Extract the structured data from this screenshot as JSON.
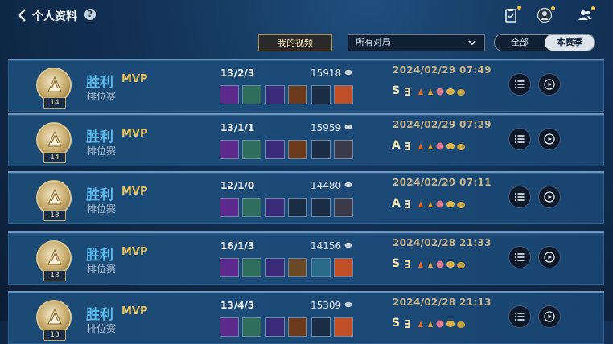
{
  "header": {
    "title": "个人资料",
    "help_label": "?",
    "icons": [
      "back-icon",
      "help-icon",
      "clipboard-icon",
      "avatar-icon",
      "friends-icon"
    ]
  },
  "filters": {
    "my_videos_label": "我的视频",
    "dropdown_value": "所有对局",
    "segment_all": "全部",
    "segment_season": "本赛季"
  },
  "matches": [
    {
      "result": "胜利",
      "mvp": "MVP",
      "mode": "排位赛",
      "level": "14",
      "kda": "13/2/3",
      "gold": "15918",
      "date": "2024/02/29 07:49",
      "rank": "S",
      "items": [
        "#5c2a8c",
        "#2f6d5c",
        "#3a2a7a",
        "#6b3a1a",
        "",
        "#c0502a"
      ]
    },
    {
      "result": "胜利",
      "mvp": "MVP",
      "mode": "排位赛",
      "level": "14",
      "kda": "13/1/1",
      "gold": "15959",
      "date": "2024/02/29 07:29",
      "rank": "A",
      "items": [
        "#5c2a8c",
        "#2f6d5c",
        "#3a2a7a",
        "#6b3a1a",
        "",
        "#3a3a4a"
      ]
    },
    {
      "result": "胜利",
      "mvp": "MVP",
      "mode": "排位赛",
      "level": "13",
      "kda": "12/1/0",
      "gold": "14480",
      "date": "2024/02/29 07:11",
      "rank": "A",
      "items": [
        "#5c2a8c",
        "#2f6d5c",
        "#3a2a7a",
        "",
        "",
        "#3a3a4a"
      ]
    },
    {
      "result": "胜利",
      "mvp": "MVP",
      "mode": "排位赛",
      "level": "13",
      "kda": "16/1/3",
      "gold": "14156",
      "date": "2024/02/28 21:33",
      "rank": "S",
      "items": [
        "#5c2a8c",
        "#2f6d5c",
        "#3a2a7a",
        "#6b4a2a",
        "#2a6a8a",
        "#c0502a"
      ]
    },
    {
      "result": "胜利",
      "mvp": "MVP",
      "mode": "排位赛",
      "level": "13",
      "kda": "13/4/3",
      "gold": "15309",
      "date": "2024/02/28 21:13",
      "rank": "S",
      "items": [
        "#5c2a8c",
        "#2f6d5c",
        "#3a2a7a",
        "#6b3a1a",
        "",
        "#c0502a"
      ]
    }
  ],
  "colors": {
    "win": "#5cb8ea",
    "mvp": "#e8c35f",
    "date": "#c9b48a"
  }
}
